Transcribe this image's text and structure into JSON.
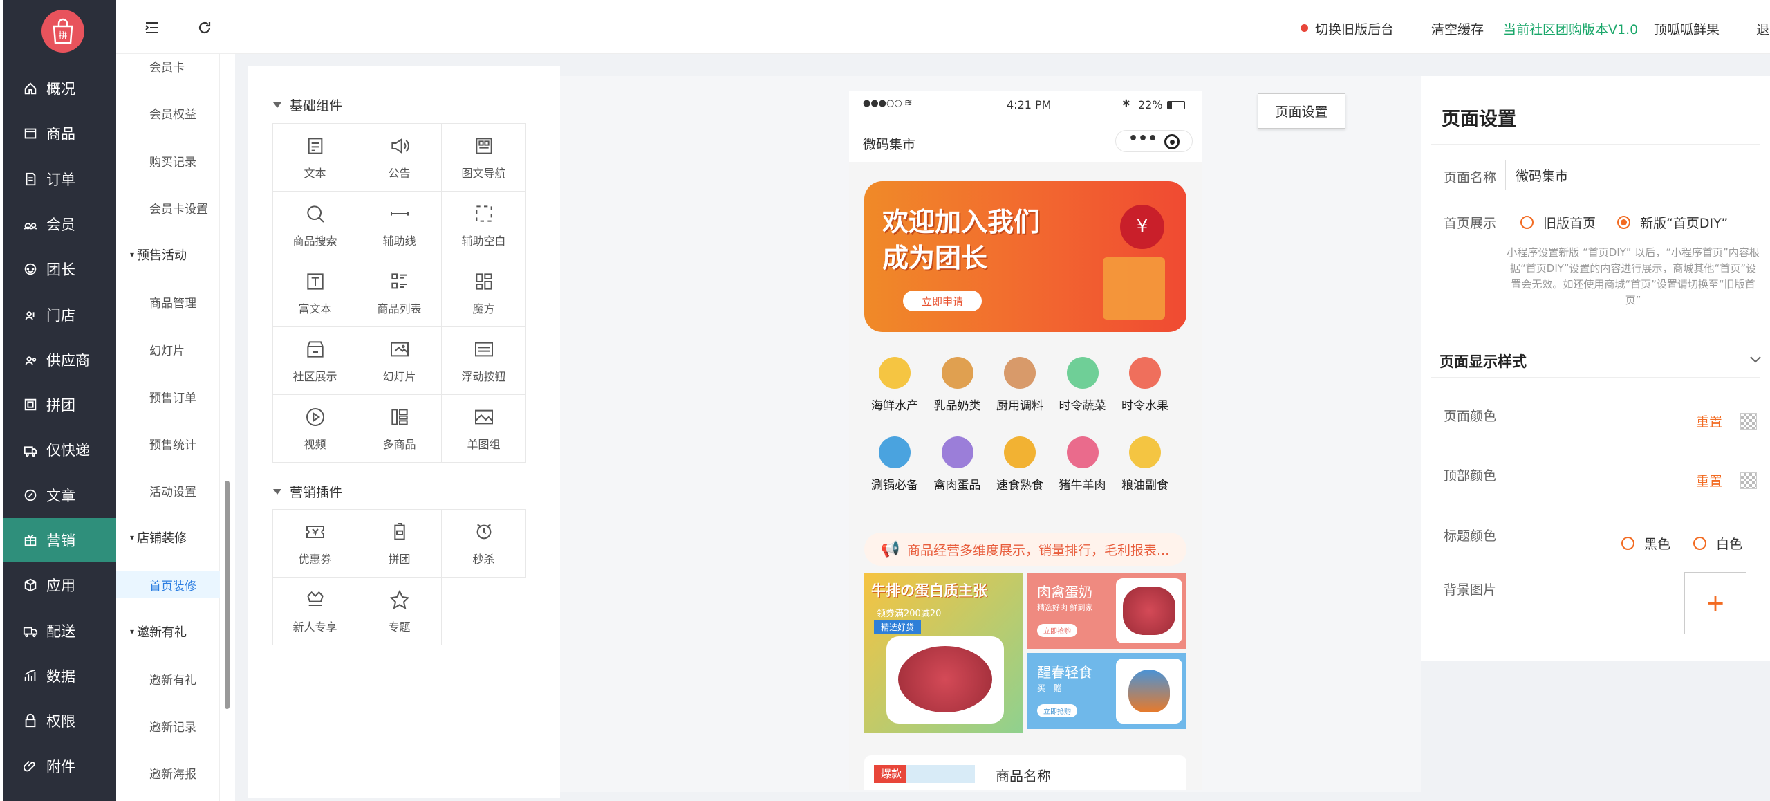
{
  "nav": {
    "items": [
      {
        "label": "概况",
        "icon": "home-icon"
      },
      {
        "label": "商品",
        "icon": "goods-icon"
      },
      {
        "label": "订单",
        "icon": "order-icon"
      },
      {
        "label": "会员",
        "icon": "member-icon"
      },
      {
        "label": "团长",
        "icon": "leader-icon"
      },
      {
        "label": "门店",
        "icon": "store-icon"
      },
      {
        "label": "供应商",
        "icon": "supplier-icon"
      },
      {
        "label": "拼团",
        "icon": "group-buy-icon"
      },
      {
        "label": "仅快递",
        "icon": "express-icon"
      },
      {
        "label": "文章",
        "icon": "article-icon"
      },
      {
        "label": "营销",
        "icon": "marketing-icon"
      },
      {
        "label": "应用",
        "icon": "app-icon"
      },
      {
        "label": "配送",
        "icon": "delivery-icon"
      },
      {
        "label": "数据",
        "icon": "data-icon"
      },
      {
        "label": "权限",
        "icon": "permission-icon"
      },
      {
        "label": "附件",
        "icon": "attachment-icon"
      }
    ],
    "active_index": 10
  },
  "subnav": [
    {
      "label": "会员卡",
      "type": "leaf"
    },
    {
      "label": "会员权益",
      "type": "leaf"
    },
    {
      "label": "购买记录",
      "type": "leaf"
    },
    {
      "label": "会员卡设置",
      "type": "leaf"
    },
    {
      "label": "预售活动",
      "type": "group"
    },
    {
      "label": "商品管理",
      "type": "leaf"
    },
    {
      "label": "幻灯片",
      "type": "leaf"
    },
    {
      "label": "预售订单",
      "type": "leaf"
    },
    {
      "label": "预售统计",
      "type": "leaf"
    },
    {
      "label": "活动设置",
      "type": "leaf"
    },
    {
      "label": "店铺装修",
      "type": "group"
    },
    {
      "label": "首页装修",
      "type": "leaf",
      "active": true
    },
    {
      "label": "邀新有礼",
      "type": "group"
    },
    {
      "label": "邀新有礼",
      "type": "leaf"
    },
    {
      "label": "邀新记录",
      "type": "leaf"
    },
    {
      "label": "邀新海报",
      "type": "leaf"
    }
  ],
  "topbar": {
    "switch_old": "切换旧版后台",
    "clear_cache": "清空缓存",
    "version": "当前社区团购版本V1.0",
    "shop": "顶呱呱鲜果",
    "logout": "退"
  },
  "components": {
    "basic_title": "基础组件",
    "basic": [
      "文本",
      "公告",
      "图文导航",
      "商品搜索",
      "辅助线",
      "辅助空白",
      "富文本",
      "商品列表",
      "魔方",
      "社区展示",
      "幻灯片",
      "浮动按钮",
      "视频",
      "多商品",
      "单图组"
    ],
    "marketing_title": "营销插件",
    "marketing": [
      "优惠券",
      "拼团",
      "秒杀",
      "新人专享",
      "专题"
    ]
  },
  "phone": {
    "signal": "●●●○○",
    "time": "4:21 PM",
    "battery": "22%",
    "title": "微码集市",
    "banner_line1": "欢迎加入我们",
    "banner_line2": "成为团长",
    "banner_btn": "立即申请",
    "categories": [
      "海鲜水产",
      "乳品奶类",
      "厨用调料",
      "时令蔬菜",
      "时令水果",
      "涮锅必备",
      "禽肉蛋品",
      "速食熟食",
      "猪牛羊肉",
      "粮油副食"
    ],
    "category_colors": [
      "#f5c542",
      "#e0a050",
      "#d89a6a",
      "#6fcf97",
      "#ef6f5c",
      "#4aa3df",
      "#9b7ed9",
      "#f2b233",
      "#ea6b8c",
      "#f4c542"
    ],
    "notice": "商品经营多维度展示，销量排行，毛利报表...",
    "card_big_title": "牛排の蛋白质主张",
    "card_big_sub": "领券满200减20",
    "card_big_tag": "精选好货",
    "card1_title": "肉禽蛋奶",
    "card1_sub": "精选好肉 鲜到家",
    "card1_btn": "立即抢购",
    "card2_title": "醒春轻食",
    "card2_sub": "买一赠一",
    "card2_btn": "立即抢购",
    "goods_tag": "爆款",
    "goods_name": "商品名称"
  },
  "page_settings_button": "页面设置",
  "settings": {
    "title": "页面设置",
    "name_label": "页面名称",
    "name_value": "微码集市",
    "home_label": "首页展示",
    "opt_old": "旧版首页",
    "opt_new": "新版“首页DIY”",
    "hint": "小程序设置新版 “首页DIY” 以后，“小程序首页”内容根据“首页DIY”设置的内容进行展示，商城其他“首页”设置会无效。如还使用商城“首页”设置请切换至“旧版首页”",
    "style_title": "页面显示样式",
    "page_color": "页面颜色",
    "top_color": "顶部颜色",
    "reset": "重置",
    "title_color": "标题颜色",
    "black": "黑色",
    "white": "白色",
    "bg_image": "背景图片",
    "upload": "+"
  },
  "colors": {
    "accent": "#f26b22",
    "nav_bg": "#2b2f3a",
    "nav_active": "#2f8f7b",
    "version": "#1aa76a"
  }
}
